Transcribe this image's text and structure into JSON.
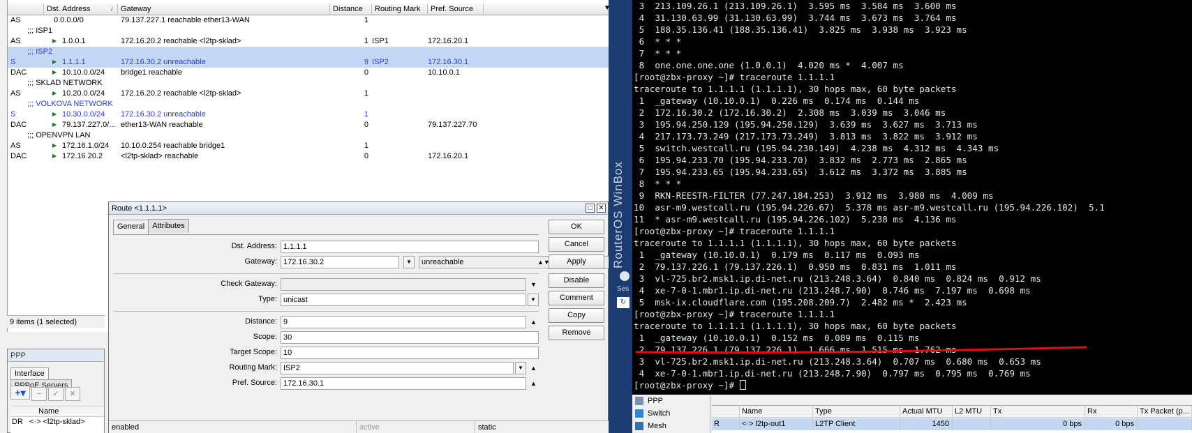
{
  "routes": {
    "columns": {
      "flags": "",
      "dst": "Dst. Address",
      "gateway": "Gateway",
      "distance": "Distance",
      "mark": "Routing Mark",
      "pref": "Pref. Source"
    },
    "sort_glyph": "/",
    "menu_glyph": "▼",
    "comments": [
      ";;; ISP1",
      ";;; ISP2",
      ";;; SKLAD NETWORK",
      ";;; VOLKOVA NETWORK",
      ";;; OPENVPN LAN"
    ],
    "rows": [
      {
        "flags": "AS",
        "dst": "0.0.0.0/0",
        "gateway": "79.137.227.1 reachable ether13-WAN",
        "distance": "1",
        "mark": "",
        "pref": ""
      },
      {
        "flags": "AS",
        "dst": "1.0.0.1",
        "gateway": "172.16.20.2 reachable <l2tp-sklad>",
        "distance": "1",
        "mark": "ISP1",
        "pref": "172.16.20.1"
      },
      {
        "flags": "S",
        "dst": "1.1.1.1",
        "gateway": "172.16.30.2 unreachable",
        "distance": "9",
        "mark": "ISP2",
        "pref": "172.16.30.1"
      },
      {
        "flags": "DAC",
        "dst": "10.10.0.0/24",
        "gateway": "bridge1 reachable",
        "distance": "0",
        "mark": "",
        "pref": "10.10.0.1"
      },
      {
        "flags": "AS",
        "dst": "10.20.0.0/24",
        "gateway": "172.16.20.2 reachable <l2tp-sklad>",
        "distance": "1",
        "mark": "",
        "pref": ""
      },
      {
        "flags": "S",
        "dst": "10.30.0.0/24",
        "gateway": "172.16.30.2 unreachable",
        "distance": "1",
        "mark": "",
        "pref": ""
      },
      {
        "flags": "DAC",
        "dst": "79.137.227.0/...",
        "gateway": "ether13-WAN reachable",
        "distance": "0",
        "mark": "",
        "pref": "79.137.227.70"
      },
      {
        "flags": "AS",
        "dst": "172.16.1.0/24",
        "gateway": "10.10.0.254 reachable bridge1",
        "distance": "1",
        "mark": "",
        "pref": ""
      },
      {
        "flags": "DAC",
        "dst": "172.16.20.2",
        "gateway": "<l2tp-sklad> reachable",
        "distance": "0",
        "mark": "",
        "pref": "172.16.20.1"
      }
    ],
    "status": "9 items (1 selected)"
  },
  "ppp_left": {
    "title": "PPP",
    "tabs": [
      "Interface",
      "PPPoE Servers"
    ],
    "col_name": "Name",
    "row": {
      "flags": "DR",
      "name": "<·> <l2tp-sklad>"
    }
  },
  "dialog": {
    "title": "Route <1.1.1.1>",
    "tabs": [
      "General",
      "Attributes"
    ],
    "fields": {
      "dst_label": "Dst. Address:",
      "dst_value": "1.1.1.1",
      "gw_label": "Gateway:",
      "gw_value": "172.16.30.2",
      "gw_state": "unreachable",
      "check_label": "Check Gateway:",
      "check_value": "",
      "type_label": "Type:",
      "type_value": "unicast",
      "distance_label": "Distance:",
      "distance_value": "9",
      "scope_label": "Scope:",
      "scope_value": "30",
      "target_label": "Target Scope:",
      "target_value": "10",
      "mark_label": "Routing Mark:",
      "mark_value": "ISP2",
      "pref_label": "Pref. Source:",
      "pref_value": "172.16.30.1"
    },
    "buttons": [
      "OK",
      "Cancel",
      "Apply",
      "Disable",
      "Comment",
      "Copy",
      "Remove"
    ],
    "status": [
      "enabled",
      "active",
      "static"
    ]
  },
  "terminal": {
    "lines": [
      " 3  213.109.26.1 (213.109.26.1)  3.595 ms  3.584 ms  3.600 ms",
      " 4  31.130.63.99 (31.130.63.99)  3.744 ms  3.673 ms  3.764 ms",
      " 5  188.35.136.41 (188.35.136.41)  3.825 ms  3.938 ms  3.923 ms",
      " 6  * * *",
      " 7  * * *",
      " 8  one.one.one.one (1.0.0.1)  4.020 ms *  4.007 ms",
      "[root@zbx-proxy ~]# traceroute 1.1.1.1",
      "traceroute to 1.1.1.1 (1.1.1.1), 30 hops max, 60 byte packets",
      " 1  _gateway (10.10.0.1)  0.226 ms  0.174 ms  0.144 ms",
      " 2  172.16.30.2 (172.16.30.2)  2.308 ms  3.039 ms  3.046 ms",
      " 3  195.94.250.129 (195.94.250.129)  3.639 ms  3.627 ms  3.713 ms",
      " 4  217.173.73.249 (217.173.73.249)  3.813 ms  3.822 ms  3.912 ms",
      " 5  switch.westcall.ru (195.94.230.149)  4.238 ms  4.312 ms  4.343 ms",
      " 6  195.94.233.70 (195.94.233.70)  3.832 ms  2.773 ms  2.865 ms",
      " 7  195.94.233.65 (195.94.233.65)  3.612 ms  3.372 ms  3.885 ms",
      " 8  * * *",
      " 9  RKN-REESTR-FILTER (77.247.184.253)  3.912 ms  3.980 ms  4.009 ms",
      "10  asr-m9.westcall.ru (195.94.226.67)  5.378 ms asr-m9.westcall.ru (195.94.226.102)  5.1",
      "11  * asr-m9.westcall.ru (195.94.226.102)  5.238 ms  4.136 ms",
      "[root@zbx-proxy ~]# traceroute 1.1.1.1",
      "traceroute to 1.1.1.1 (1.1.1.1), 30 hops max, 60 byte packets",
      " 1  _gateway (10.10.0.1)  0.179 ms  0.117 ms  0.093 ms",
      " 2  79.137.226.1 (79.137.226.1)  0.950 ms  0.831 ms  1.011 ms",
      " 3  vl-725.br2.msk1.ip.di-net.ru (213.248.3.64)  0.840 ms  0.824 ms  0.912 ms",
      " 4  xe-7-0-1.mbr1.ip.di-net.ru (213.248.7.90)  0.746 ms  7.197 ms  0.698 ms",
      " 5  msk-ix.cloudflare.com (195.208.209.7)  2.482 ms *  2.423 ms",
      "[root@zbx-proxy ~]# traceroute 1.1.1.1",
      "traceroute to 1.1.1.1 (1.1.1.1), 30 hops max, 60 byte packets",
      " 1  _gateway (10.10.0.1)  0.152 ms  0.089 ms  0.115 ms",
      " 2  79.137.226.1 (79.137.226.1)  1.666 ms  1.515 ms  1.762 ms",
      " 3  vl-725.br2.msk1.ip.di-net.ru (213.248.3.64)  0.707 ms  0.680 ms  0.653 ms",
      " 4  xe-7-0-1.mbr1.ip.di-net.ru (213.248.7.90)  0.797 ms  0.795 ms  0.769 ms"
    ],
    "prompt": "[root@zbx-proxy ~]# "
  },
  "winbox": {
    "label": "RouterOS WinBox",
    "side_text": "Ses"
  },
  "sidebar_menu": [
    "PPP",
    "Switch",
    "Mesh"
  ],
  "ppp_right": {
    "columns": [
      "",
      "Name",
      "Type",
      "Actual MTU",
      "L2 MTU",
      "Tx",
      "Rx",
      "Tx Packet (p..."
    ],
    "row": [
      "R",
      "<·> l2tp-out1",
      "L2TP Client",
      "1450",
      "",
      "0 bps",
      "0 bps",
      ""
    ]
  },
  "colors": {
    "selection": "#c4d8f4",
    "disabled_blue": "#2a3bd9",
    "terminal_bg": "#000000",
    "annotation_red": "#e01010",
    "winbox_blue": "#1c3b6f"
  }
}
